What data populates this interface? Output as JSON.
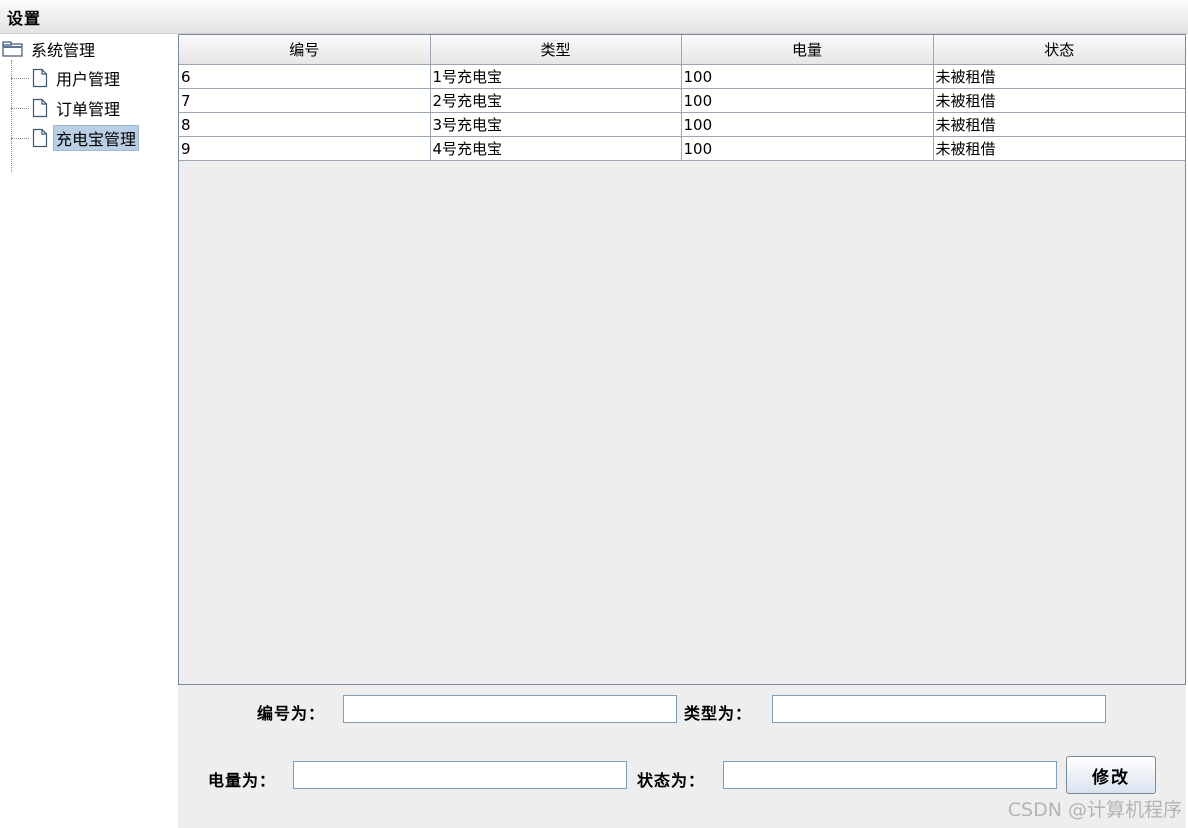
{
  "menubar": {
    "menu_label": "设置"
  },
  "tree": {
    "root_label": "系统管理",
    "children": [
      {
        "label": "用户管理"
      },
      {
        "label": "订单管理"
      },
      {
        "label": "充电宝管理",
        "selected": true
      }
    ]
  },
  "table": {
    "headers": [
      "编号",
      "类型",
      "电量",
      "状态"
    ],
    "rows": [
      [
        "6",
        "1号充电宝",
        "100",
        "未被租借"
      ],
      [
        "7",
        "2号充电宝",
        "100",
        "未被租借"
      ],
      [
        "8",
        "3号充电宝",
        "100",
        "未被租借"
      ],
      [
        "9",
        "4号充电宝",
        "100",
        "未被租借"
      ]
    ]
  },
  "form": {
    "id_label": "编号为：",
    "id_value": "",
    "type_label": "类型为：",
    "type_value": "",
    "battery_label": "电量为：",
    "battery_value": "",
    "status_label": "状态为：",
    "status_value": "",
    "modify_button": "修改"
  },
  "watermark": "CSDN @计算机程序",
  "colors": {
    "selection": "#b8cfe5",
    "panel_bg": "#eeeeee",
    "grid_line": "#9aa6b2",
    "input_border": "#7f9db9"
  }
}
